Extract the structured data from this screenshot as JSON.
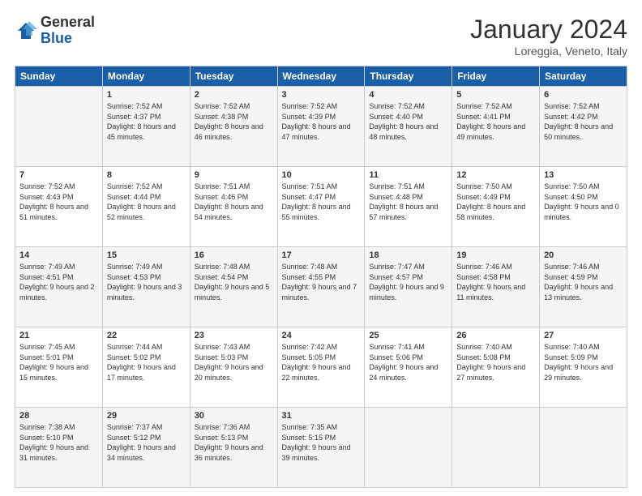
{
  "header": {
    "logo_general": "General",
    "logo_blue": "Blue",
    "month_title": "January 2024",
    "location": "Loreggia, Veneto, Italy"
  },
  "weekdays": [
    "Sunday",
    "Monday",
    "Tuesday",
    "Wednesday",
    "Thursday",
    "Friday",
    "Saturday"
  ],
  "weeks": [
    [
      {
        "day": "",
        "sunrise": "",
        "sunset": "",
        "daylight": ""
      },
      {
        "day": "1",
        "sunrise": "Sunrise: 7:52 AM",
        "sunset": "Sunset: 4:37 PM",
        "daylight": "Daylight: 8 hours and 45 minutes."
      },
      {
        "day": "2",
        "sunrise": "Sunrise: 7:52 AM",
        "sunset": "Sunset: 4:38 PM",
        "daylight": "Daylight: 8 hours and 46 minutes."
      },
      {
        "day": "3",
        "sunrise": "Sunrise: 7:52 AM",
        "sunset": "Sunset: 4:39 PM",
        "daylight": "Daylight: 8 hours and 47 minutes."
      },
      {
        "day": "4",
        "sunrise": "Sunrise: 7:52 AM",
        "sunset": "Sunset: 4:40 PM",
        "daylight": "Daylight: 8 hours and 48 minutes."
      },
      {
        "day": "5",
        "sunrise": "Sunrise: 7:52 AM",
        "sunset": "Sunset: 4:41 PM",
        "daylight": "Daylight: 8 hours and 49 minutes."
      },
      {
        "day": "6",
        "sunrise": "Sunrise: 7:52 AM",
        "sunset": "Sunset: 4:42 PM",
        "daylight": "Daylight: 8 hours and 50 minutes."
      }
    ],
    [
      {
        "day": "7",
        "sunrise": "Sunrise: 7:52 AM",
        "sunset": "Sunset: 4:43 PM",
        "daylight": "Daylight: 8 hours and 51 minutes."
      },
      {
        "day": "8",
        "sunrise": "Sunrise: 7:52 AM",
        "sunset": "Sunset: 4:44 PM",
        "daylight": "Daylight: 8 hours and 52 minutes."
      },
      {
        "day": "9",
        "sunrise": "Sunrise: 7:51 AM",
        "sunset": "Sunset: 4:46 PM",
        "daylight": "Daylight: 8 hours and 54 minutes."
      },
      {
        "day": "10",
        "sunrise": "Sunrise: 7:51 AM",
        "sunset": "Sunset: 4:47 PM",
        "daylight": "Daylight: 8 hours and 55 minutes."
      },
      {
        "day": "11",
        "sunrise": "Sunrise: 7:51 AM",
        "sunset": "Sunset: 4:48 PM",
        "daylight": "Daylight: 8 hours and 57 minutes."
      },
      {
        "day": "12",
        "sunrise": "Sunrise: 7:50 AM",
        "sunset": "Sunset: 4:49 PM",
        "daylight": "Daylight: 8 hours and 58 minutes."
      },
      {
        "day": "13",
        "sunrise": "Sunrise: 7:50 AM",
        "sunset": "Sunset: 4:50 PM",
        "daylight": "Daylight: 9 hours and 0 minutes."
      }
    ],
    [
      {
        "day": "14",
        "sunrise": "Sunrise: 7:49 AM",
        "sunset": "Sunset: 4:51 PM",
        "daylight": "Daylight: 9 hours and 2 minutes."
      },
      {
        "day": "15",
        "sunrise": "Sunrise: 7:49 AM",
        "sunset": "Sunset: 4:53 PM",
        "daylight": "Daylight: 9 hours and 3 minutes."
      },
      {
        "day": "16",
        "sunrise": "Sunrise: 7:48 AM",
        "sunset": "Sunset: 4:54 PM",
        "daylight": "Daylight: 9 hours and 5 minutes."
      },
      {
        "day": "17",
        "sunrise": "Sunrise: 7:48 AM",
        "sunset": "Sunset: 4:55 PM",
        "daylight": "Daylight: 9 hours and 7 minutes."
      },
      {
        "day": "18",
        "sunrise": "Sunrise: 7:47 AM",
        "sunset": "Sunset: 4:57 PM",
        "daylight": "Daylight: 9 hours and 9 minutes."
      },
      {
        "day": "19",
        "sunrise": "Sunrise: 7:46 AM",
        "sunset": "Sunset: 4:58 PM",
        "daylight": "Daylight: 9 hours and 11 minutes."
      },
      {
        "day": "20",
        "sunrise": "Sunrise: 7:46 AM",
        "sunset": "Sunset: 4:59 PM",
        "daylight": "Daylight: 9 hours and 13 minutes."
      }
    ],
    [
      {
        "day": "21",
        "sunrise": "Sunrise: 7:45 AM",
        "sunset": "Sunset: 5:01 PM",
        "daylight": "Daylight: 9 hours and 15 minutes."
      },
      {
        "day": "22",
        "sunrise": "Sunrise: 7:44 AM",
        "sunset": "Sunset: 5:02 PM",
        "daylight": "Daylight: 9 hours and 17 minutes."
      },
      {
        "day": "23",
        "sunrise": "Sunrise: 7:43 AM",
        "sunset": "Sunset: 5:03 PM",
        "daylight": "Daylight: 9 hours and 20 minutes."
      },
      {
        "day": "24",
        "sunrise": "Sunrise: 7:42 AM",
        "sunset": "Sunset: 5:05 PM",
        "daylight": "Daylight: 9 hours and 22 minutes."
      },
      {
        "day": "25",
        "sunrise": "Sunrise: 7:41 AM",
        "sunset": "Sunset: 5:06 PM",
        "daylight": "Daylight: 9 hours and 24 minutes."
      },
      {
        "day": "26",
        "sunrise": "Sunrise: 7:40 AM",
        "sunset": "Sunset: 5:08 PM",
        "daylight": "Daylight: 9 hours and 27 minutes."
      },
      {
        "day": "27",
        "sunrise": "Sunrise: 7:40 AM",
        "sunset": "Sunset: 5:09 PM",
        "daylight": "Daylight: 9 hours and 29 minutes."
      }
    ],
    [
      {
        "day": "28",
        "sunrise": "Sunrise: 7:38 AM",
        "sunset": "Sunset: 5:10 PM",
        "daylight": "Daylight: 9 hours and 31 minutes."
      },
      {
        "day": "29",
        "sunrise": "Sunrise: 7:37 AM",
        "sunset": "Sunset: 5:12 PM",
        "daylight": "Daylight: 9 hours and 34 minutes."
      },
      {
        "day": "30",
        "sunrise": "Sunrise: 7:36 AM",
        "sunset": "Sunset: 5:13 PM",
        "daylight": "Daylight: 9 hours and 36 minutes."
      },
      {
        "day": "31",
        "sunrise": "Sunrise: 7:35 AM",
        "sunset": "Sunset: 5:15 PM",
        "daylight": "Daylight: 9 hours and 39 minutes."
      },
      {
        "day": "",
        "sunrise": "",
        "sunset": "",
        "daylight": ""
      },
      {
        "day": "",
        "sunrise": "",
        "sunset": "",
        "daylight": ""
      },
      {
        "day": "",
        "sunrise": "",
        "sunset": "",
        "daylight": ""
      }
    ]
  ]
}
